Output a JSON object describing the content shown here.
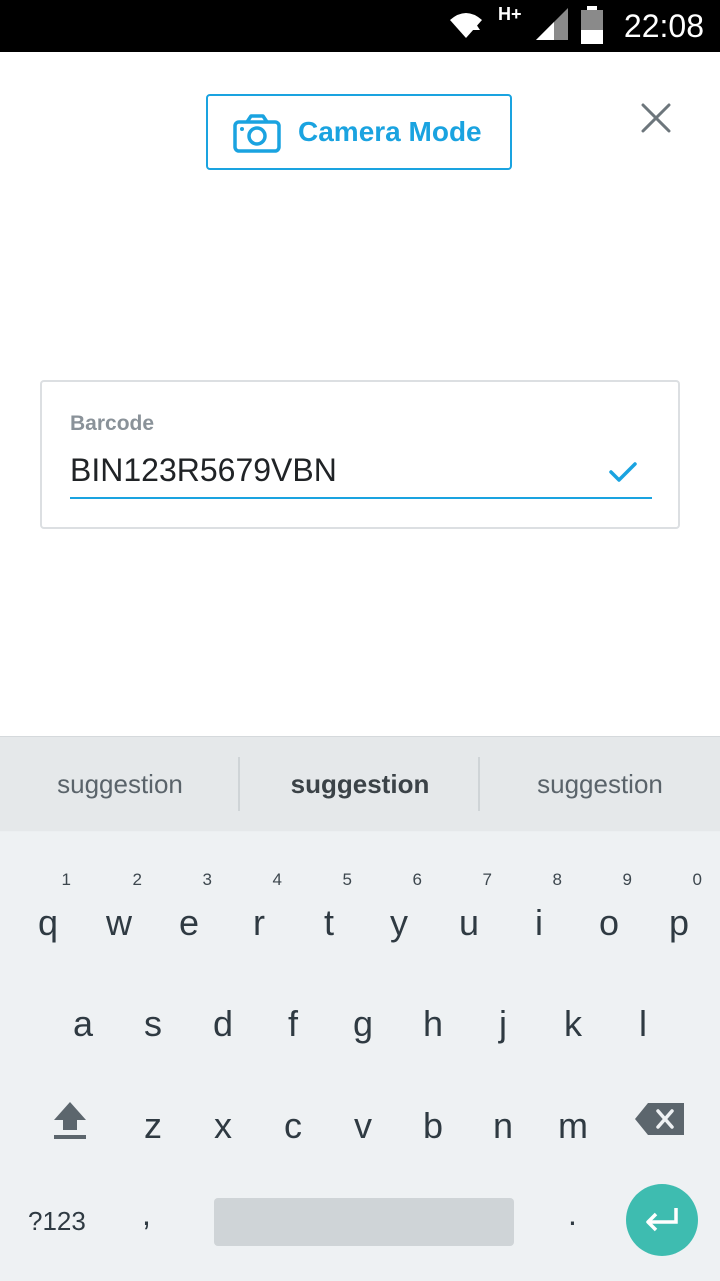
{
  "status_bar": {
    "time": "22:08",
    "network_label": "H+",
    "icons": [
      "wifi-icon",
      "signal-icon",
      "battery-icon"
    ]
  },
  "header": {
    "camera_button_label": "Camera Mode",
    "close_icon": "close-icon"
  },
  "barcode_field": {
    "label": "Barcode",
    "value": "BIN123R5679VBN",
    "status_icon": "check-icon"
  },
  "keyboard": {
    "suggestions": [
      "suggestion",
      "suggestion",
      "suggestion"
    ],
    "row1": [
      "q",
      "w",
      "e",
      "r",
      "t",
      "y",
      "u",
      "i",
      "o",
      "p"
    ],
    "row1_hints": [
      "1",
      "2",
      "3",
      "4",
      "5",
      "6",
      "7",
      "8",
      "9",
      "0"
    ],
    "row2": [
      "a",
      "s",
      "d",
      "f",
      "g",
      "h",
      "j",
      "k",
      "l"
    ],
    "row3": [
      "z",
      "x",
      "c",
      "v",
      "b",
      "n",
      "m"
    ],
    "symbols_label": "?123",
    "comma": ",",
    "period": ".",
    "icons": [
      "shift-icon",
      "backspace-icon",
      "enter-icon"
    ]
  },
  "colors": {
    "accent": "#1aa3e0",
    "enter_button": "#3ebcb0",
    "keyboard_bg": "#eceff1"
  }
}
